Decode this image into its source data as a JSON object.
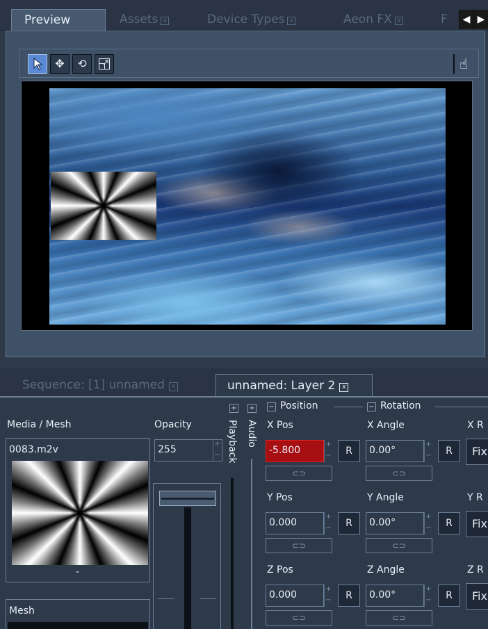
{
  "preview_window": {
    "tabs": [
      {
        "label": "Preview"
      },
      {
        "label": "Assets"
      },
      {
        "label": "Device Types"
      },
      {
        "label": "Aeon FX"
      },
      {
        "label": "F"
      }
    ],
    "toolbar": {
      "tools": [
        "select-arrow-icon",
        "move-icon",
        "rotate-icon",
        "scale-icon"
      ],
      "right_tool": "hand-icon"
    }
  },
  "layer_window": {
    "tabs": [
      {
        "label": "Sequence: [1] unnamed"
      },
      {
        "label": "unnamed: Layer 2"
      }
    ],
    "media": {
      "header": "Media / Mesh",
      "file": "0083.m2v",
      "caption": "-",
      "mesh_header": "Mesh"
    },
    "opacity": {
      "header": "Opacity",
      "value": "255"
    },
    "side_tabs": {
      "playback": "Playback",
      "audio": "Audio"
    },
    "groups": {
      "position": "Position",
      "rotation": "Rotation"
    },
    "fields": {
      "x_pos": {
        "label": "X Pos",
        "value": "-5.800"
      },
      "y_pos": {
        "label": "Y Pos",
        "value": "0.000"
      },
      "z_pos": {
        "label": "Z Pos",
        "value": "0.000"
      },
      "x_angle": {
        "label": "X Angle",
        "value": "0.00°"
      },
      "y_angle": {
        "label": "Y Angle",
        "value": "0.00°"
      },
      "z_angle": {
        "label": "Z Angle",
        "value": "0.00°"
      },
      "x_r": {
        "label": "X R"
      },
      "y_r": {
        "label": "Y R"
      },
      "z_r": {
        "label": "Z R"
      }
    },
    "reset_label": "R",
    "fix_label": "Fix",
    "colors": {
      "active_field": "#a80f12",
      "selected_tool": "#5a8ad6"
    }
  }
}
